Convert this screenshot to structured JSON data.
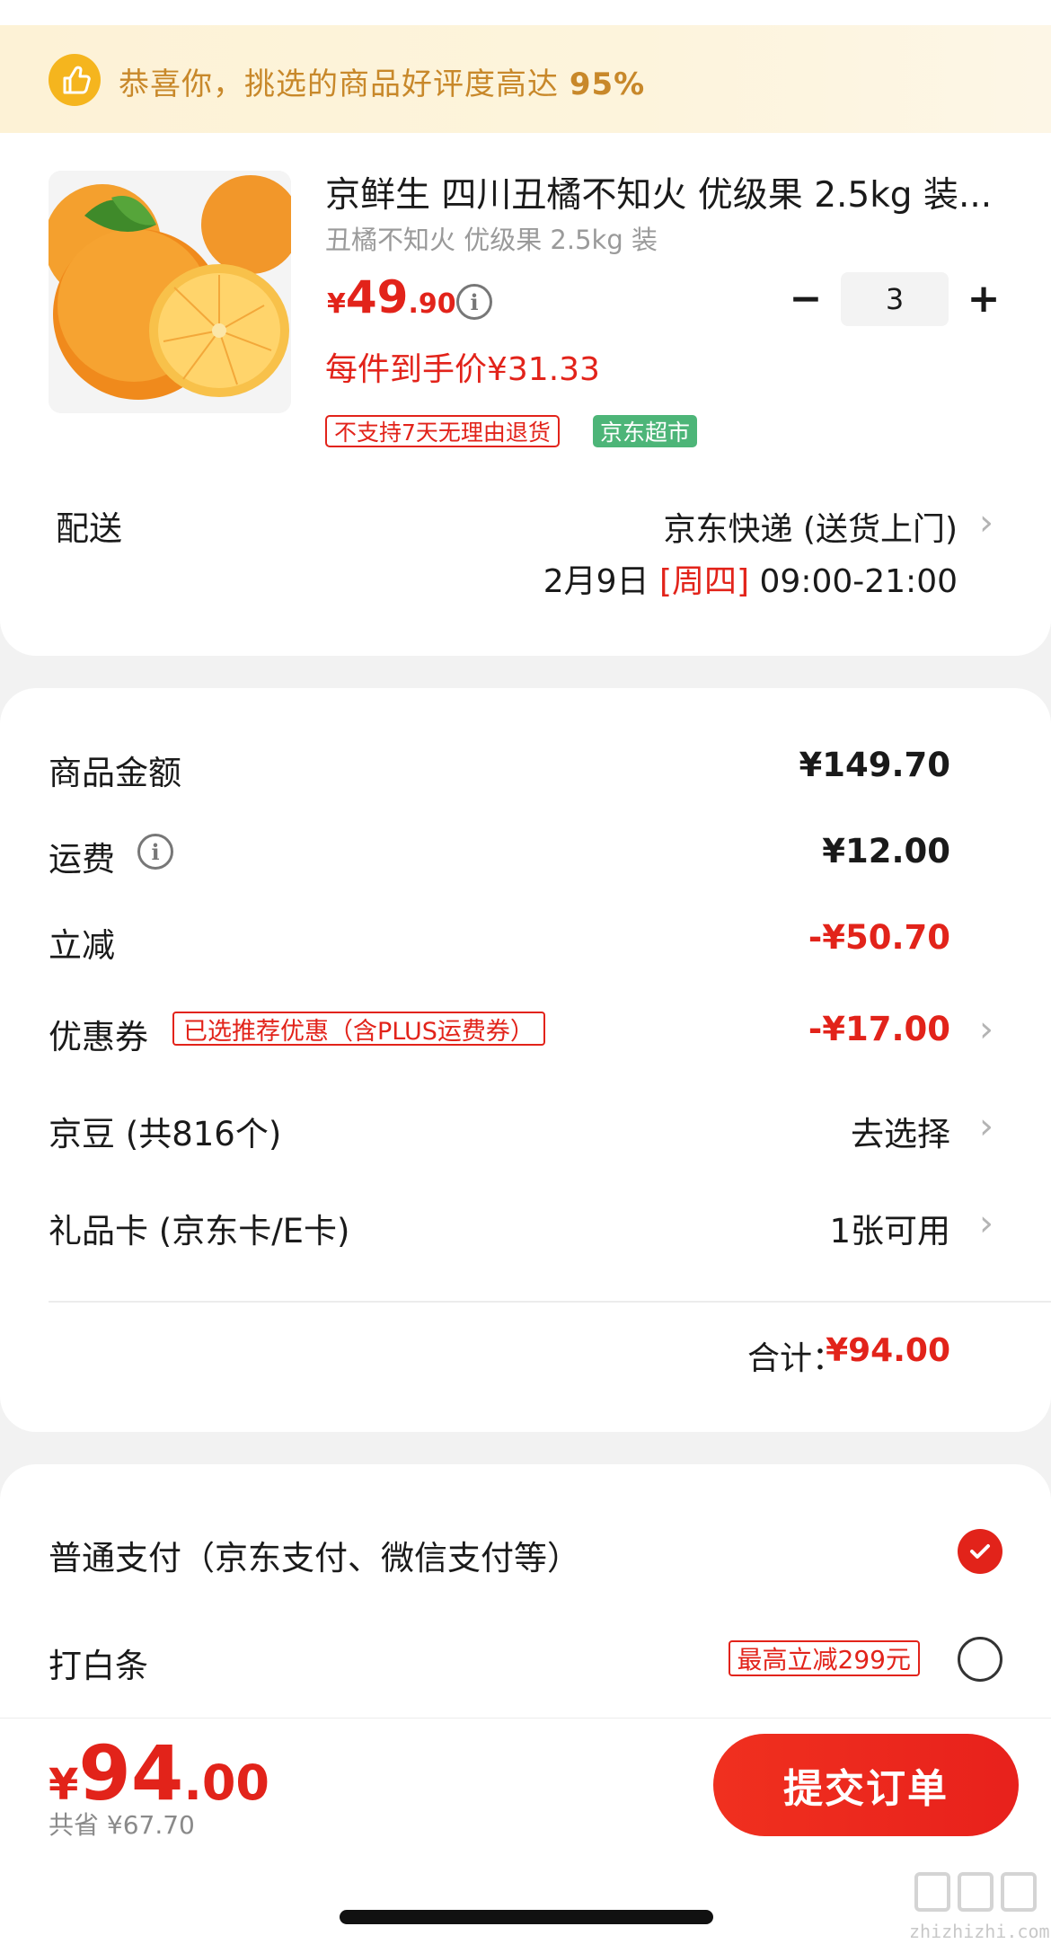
{
  "banner": {
    "text": "恭喜你，挑选的商品好评度高达",
    "rate": "95%"
  },
  "product": {
    "image_icon": "orange-fruit-image",
    "title": "京鲜生 四川丑橘不知火 优级果 2.5kg 装...",
    "spec": "丑橘不知火 优级果 2.5kg 装",
    "price_symbol": "¥",
    "price_int": "49",
    "price_dec": ".90",
    "info_icon": "i",
    "qty_minus": "−",
    "quantity": "3",
    "qty_plus": "+",
    "unit_price": "每件到手价¥31.33",
    "tag_return": "不支持7天无理由退货",
    "tag_market": "京东超市"
  },
  "delivery": {
    "label": "配送",
    "method": "京东快递 (送货上门)",
    "date": "2月9日",
    "weekday": "[周四]",
    "time": "09:00-21:00",
    "chevron": "›"
  },
  "summary": {
    "goods_label": "商品金额",
    "goods_value": "¥149.70",
    "freight_label": "运费",
    "freight_value": "¥12.00",
    "discount_label": "立减",
    "discount_value": "-¥50.70",
    "coupon_label": "优惠券",
    "coupon_tag": "已选推荐优惠（含PLUS运费券）",
    "coupon_value": "-¥17.00",
    "jingdou_label": "京豆 (共816个)",
    "jingdou_value": "去选择",
    "giftcard_label": "礼品卡 (京东卡/E卡)",
    "giftcard_value": "1张可用",
    "total_label": "合计：",
    "total_value": "¥94.00",
    "chevron": "›"
  },
  "payment": {
    "normal_label": "普通支付（京东支付、微信支付等）",
    "baitiao_label": "打白条",
    "baitiao_tag": "最高立减299元",
    "check_icon": "✓"
  },
  "footer": {
    "price_symbol": "¥",
    "price_int": "94",
    "price_dec": ".00",
    "savings": "共省 ¥67.70",
    "submit_label": "提交订单"
  },
  "watermark": {
    "text": "zhizhizhi.com"
  },
  "colors": {
    "accent_red": "#e2231a",
    "banner_text": "#c8882a",
    "market_green": "#4db578"
  }
}
